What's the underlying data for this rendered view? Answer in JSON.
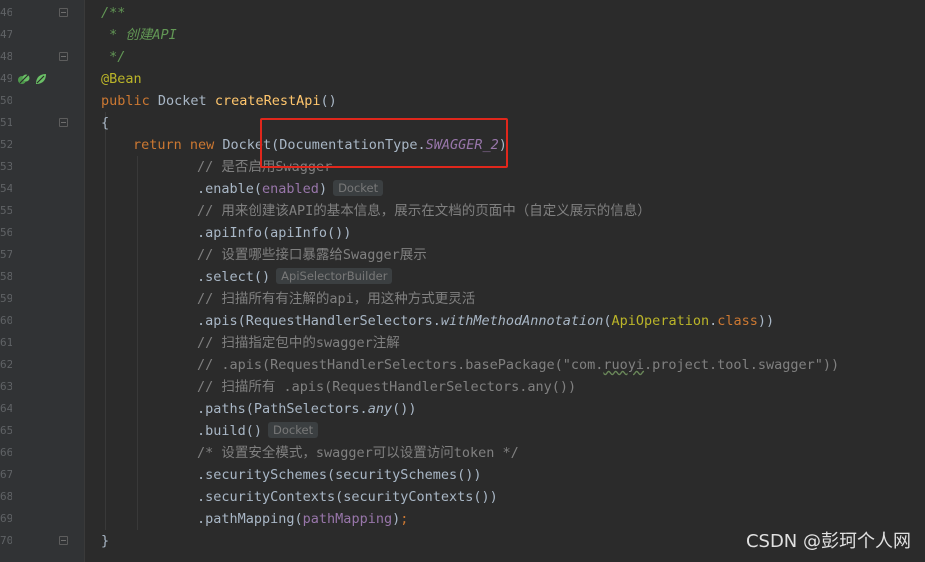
{
  "line_numbers": [
    "46",
    "47",
    "48",
    "49",
    "50",
    "51",
    "52",
    "53",
    "54",
    "55",
    "56",
    "57",
    "58",
    "59",
    "60",
    "61",
    "62",
    "63",
    "64",
    "65",
    "66",
    "67",
    "68",
    "69",
    "70"
  ],
  "code": {
    "l46": "/**",
    "l47_star": " * ",
    "l47_text": "创建API",
    "l48": " */",
    "l49": "@Bean",
    "l50_kw": "public ",
    "l50_type": "Docket ",
    "l50_fn": "createRestApi",
    "l50_rest": "()",
    "l51": "{",
    "l52_kw": "return new ",
    "l52_a": "Docket(DocumentationType.",
    "l52_field": "SWAGGER_2",
    "l52_b": ")",
    "l53": "// 是否启用Swagger",
    "l54_a": ".enable(",
    "l54_param": "enabled",
    "l54_b": ")",
    "l54_hint": "Docket",
    "l55": "// 用来创建该API的基本信息，展示在文档的页面中（自定义展示的信息）",
    "l56": ".apiInfo(apiInfo())",
    "l57": "// 设置哪些接口暴露给Swagger展示",
    "l58": ".select()",
    "l58_hint": "ApiSelectorBuilder",
    "l59": "// 扫描所有有注解的api，用这种方式更灵活",
    "l60_a": ".apis(RequestHandlerSelectors.",
    "l60_meth": "withMethodAnnotation",
    "l60_b": "(",
    "l60_ann": "ApiOperation",
    "l60_c": ".",
    "l60_kw": "class",
    "l60_d": "))",
    "l61": "// 扫描指定包中的swagger注解",
    "l62_a": "// .apis(RequestHandlerSelectors.basePackage(\"com.",
    "l62_sq": "ruoyi",
    "l62_b": ".project.tool.swagger\"))",
    "l63": "// 扫描所有 .apis(RequestHandlerSelectors.any())",
    "l64_a": ".paths(PathSelectors.",
    "l64_meth": "any",
    "l64_b": "())",
    "l65": ".build()",
    "l65_hint": "Docket",
    "l66": "/* 设置安全模式，swagger可以设置访问token */",
    "l67": ".securitySchemes(securitySchemes())",
    "l68": ".securityContexts(securityContexts())",
    "l69_a": ".pathMapping(",
    "l69_param": "pathMapping",
    "l69_b": ")",
    "l69_kw": ";",
    "l70": "}"
  },
  "watermark": "CSDN @彭珂个人网",
  "colors": {
    "highlight_box": "#e0271c",
    "keyword": "#cc7832",
    "comment": "#808080",
    "doc_comment": "#629755",
    "annotation": "#bbb529",
    "method_decl": "#ffc66d",
    "field": "#9876aa"
  }
}
